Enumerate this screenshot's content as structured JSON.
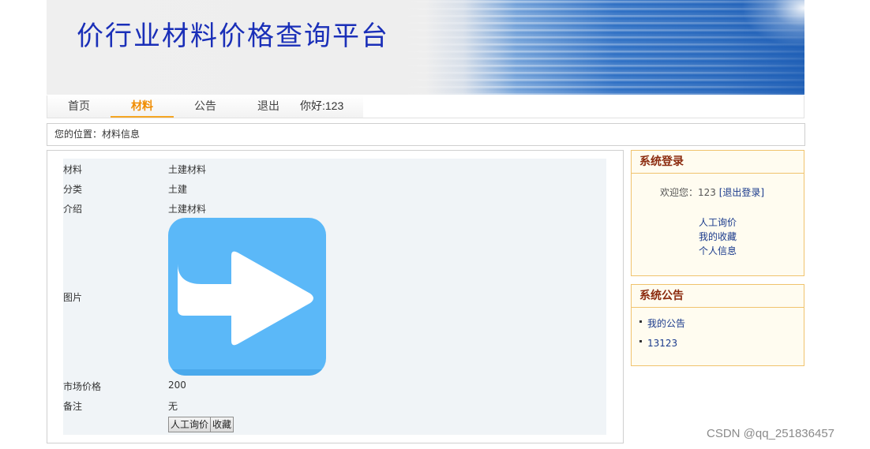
{
  "banner": {
    "title": "价行业材料价格查询平台"
  },
  "nav": {
    "items": [
      "首页",
      "材料",
      "公告",
      "退出"
    ],
    "active": "材料",
    "greeting": "你好:123"
  },
  "breadcrumb": {
    "text": "您的位置：材料信息"
  },
  "detail": {
    "labels": {
      "material": "材料",
      "category": "分类",
      "intro": "介绍",
      "image": "图片",
      "price": "市场价格",
      "remark": "备注"
    },
    "values": {
      "material": "土建材料",
      "category": "土建",
      "intro": "土建材料",
      "price": "200",
      "remark": "无"
    },
    "image_icon": "arrow-right-icon",
    "buttons": {
      "inquiry": "人工询价",
      "favorite": "收藏"
    }
  },
  "login_box": {
    "title": "系统登录",
    "welcome_prefix": "欢迎您：123",
    "logout_link": "[退出登录]",
    "links": [
      "人工询价",
      "我的收藏",
      "个人信息"
    ]
  },
  "announce_box": {
    "title": "系统公告",
    "items": [
      "我的公告",
      "13123"
    ]
  },
  "watermark": "CSDN @qq_251836457",
  "colors": {
    "title_blue": "#1a2fb8",
    "nav_active": "#f08c00",
    "sidebar_border": "#f0c36d",
    "image_bg": "#5bb8f8"
  }
}
